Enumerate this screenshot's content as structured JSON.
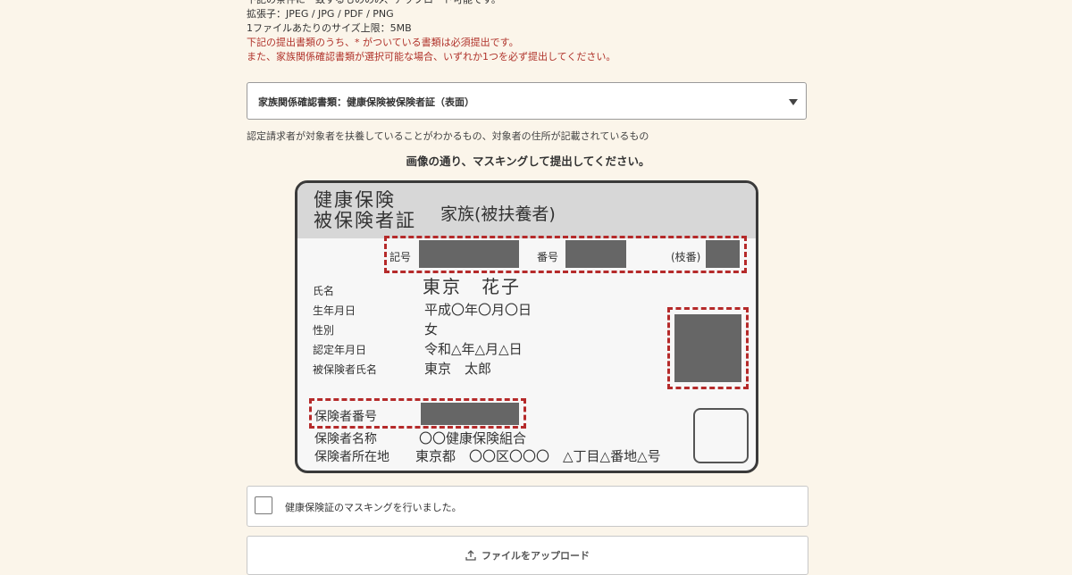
{
  "notes": {
    "line1": "下記の条件に一致するもののみ、アップロード可能です。",
    "line2": "拡張子：JPEG / JPG / PDF / PNG",
    "line3": "1ファイルあたりのサイズ上限：5MB",
    "line4": "下記の提出書類のうち、* がついている書類は必須提出です。",
    "line5": "また、家族関係確認書類が選択可能な場合、いずれか1つを必ず提出してください。"
  },
  "document_select": {
    "value": "家族関係確認書類：健康保険被保険者証（表面）"
  },
  "hint": "認定請求者が対象者を扶養していることがわかるもの、対象者の住所が記載されているもの",
  "mask_instruction": "画像の通り、マスキングして提出してください。",
  "card": {
    "title_line1": "健康保険",
    "title_line2": "被保険者証",
    "subtitle": "家族(被扶養者)",
    "kigo_label": "記号",
    "bango_label": "番号",
    "edaban_label": "(枝番)",
    "name_label": "氏名",
    "name_value": "東京　花子",
    "birth_label": "生年月日",
    "birth_value": "平成〇年〇月〇日",
    "sex_label": "性別",
    "sex_value": "女",
    "cert_label": "認定年月日",
    "cert_value": "令和△年△月△日",
    "insured_label": "被保険者氏名",
    "insured_value": "東京　太郎",
    "insurer_no_label": "保険者番号",
    "insurer_name_label": "保険者名称",
    "insurer_name_value": "〇〇健康保険組合",
    "insurer_addr_label": "保険者所在地",
    "insurer_addr_value": "東京都　〇〇区〇〇〇　△丁目△番地△号"
  },
  "masking_checkbox": {
    "label": "健康保険証のマスキングを行いました。",
    "checked": false
  },
  "upload": {
    "label": "ファイルをアップロード"
  },
  "colors": {
    "background": "#fbf5ea",
    "warning_text": "#b0332b",
    "mask_dash": "#b52a2a",
    "mask_block": "#666666"
  }
}
